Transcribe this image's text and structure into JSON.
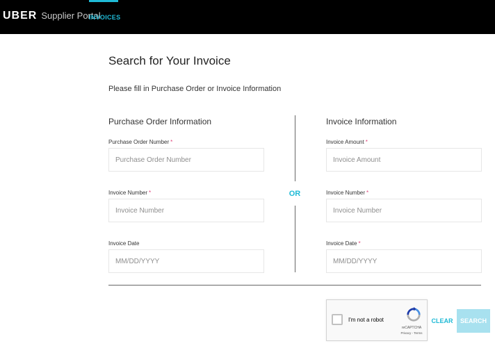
{
  "header": {
    "logo": "UBER",
    "portal_name": "Supplier Portal",
    "tabs": [
      {
        "label": "INVOICES",
        "active": true
      }
    ],
    "accent_color": "#1fbad6"
  },
  "main": {
    "title": "Search for Your Invoice",
    "subtitle": "Please fill in Purchase Order or Invoice Information",
    "or_label": "OR"
  },
  "purchase_order": {
    "section_title": "Purchase Order Information",
    "fields": [
      {
        "label": "Purchase Order Number",
        "required": "*",
        "placeholder": "Purchase Order Number",
        "value": ""
      },
      {
        "label": "Invoice Number",
        "required": "*",
        "placeholder": "Invoice Number",
        "value": ""
      },
      {
        "label": "Invoice Date",
        "required": "",
        "placeholder": "MM/DD/YYYY",
        "value": ""
      }
    ]
  },
  "invoice_info": {
    "section_title": "Invoice Information",
    "fields": [
      {
        "label": "Invoice Amount",
        "required": "*",
        "placeholder": "Invoice Amount",
        "value": ""
      },
      {
        "label": "Invoice Number",
        "required": "*",
        "placeholder": "Invoice Number",
        "value": ""
      },
      {
        "label": "Invoice Date",
        "required": "*",
        "placeholder": "MM/DD/YYYY",
        "value": ""
      }
    ]
  },
  "captcha": {
    "label": "I'm not a robot",
    "brand": "reCAPTCHA",
    "links": "Privacy - Terms",
    "icon": "recaptcha-icon"
  },
  "actions": {
    "clear_label": "CLEAR",
    "search_label": "SEARCH"
  }
}
